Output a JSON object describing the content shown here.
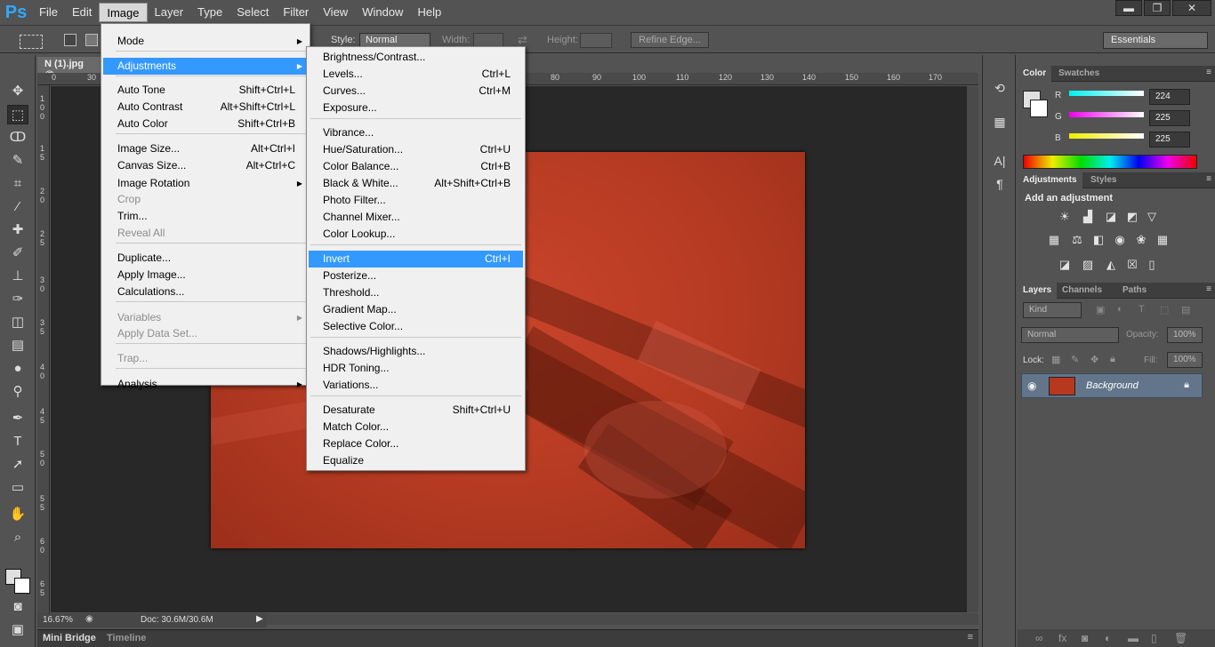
{
  "app": {
    "logo": "Ps"
  },
  "menubar": [
    "File",
    "Edit",
    "Image",
    "Layer",
    "Type",
    "Select",
    "Filter",
    "View",
    "Window",
    "Help"
  ],
  "window_controls": {
    "minimize": "▬",
    "restore": "❐",
    "close": "✕"
  },
  "options": {
    "style_label": "Style:",
    "style_value": "Normal",
    "width_label": "Width:",
    "height_label": "Height:",
    "refine_edge": "Refine Edge...",
    "workspace": "Essentials"
  },
  "document": {
    "tab": "N (1).jpg @",
    "zoom": "16.67%",
    "doc_size": "Doc: 30.6M/30.6M"
  },
  "ruler_top_ticks": [
    "0",
    "30",
    "80",
    "90",
    "100",
    "110",
    "120",
    "130",
    "140",
    "150",
    "160",
    "170"
  ],
  "ruler_left_ticks": [
    "1",
    "0",
    "0",
    "1",
    "5",
    "2",
    "0",
    "2",
    "5",
    "3",
    "0",
    "3",
    "5",
    "4",
    "0",
    "4",
    "5",
    "5",
    "0",
    "5",
    "5",
    "6",
    "0",
    "6",
    "5"
  ],
  "bottom_tabs": {
    "mini_bridge": "Mini Bridge",
    "timeline": "Timeline"
  },
  "image_menu": {
    "items": [
      {
        "label": "Mode",
        "shortcut": "",
        "submenu": true,
        "disabled": false
      },
      {
        "label": "Adjustments",
        "shortcut": "",
        "submenu": true,
        "disabled": false,
        "highlighted": true
      },
      {
        "label": "Auto Tone",
        "shortcut": "Shift+Ctrl+L",
        "disabled": false
      },
      {
        "label": "Auto Contrast",
        "shortcut": "Alt+Shift+Ctrl+L",
        "disabled": false
      },
      {
        "label": "Auto Color",
        "shortcut": "Shift+Ctrl+B",
        "disabled": false
      },
      {
        "label": "Image Size...",
        "shortcut": "Alt+Ctrl+I",
        "disabled": false
      },
      {
        "label": "Canvas Size...",
        "shortcut": "Alt+Ctrl+C",
        "disabled": false
      },
      {
        "label": "Image Rotation",
        "shortcut": "",
        "submenu": true,
        "disabled": false
      },
      {
        "label": "Crop",
        "shortcut": "",
        "disabled": true
      },
      {
        "label": "Trim...",
        "shortcut": "",
        "disabled": false
      },
      {
        "label": "Reveal All",
        "shortcut": "",
        "disabled": true
      },
      {
        "label": "Duplicate...",
        "shortcut": "",
        "disabled": false
      },
      {
        "label": "Apply Image...",
        "shortcut": "",
        "disabled": false
      },
      {
        "label": "Calculations...",
        "shortcut": "",
        "disabled": false
      },
      {
        "label": "Variables",
        "shortcut": "",
        "submenu": true,
        "disabled": true
      },
      {
        "label": "Apply Data Set...",
        "shortcut": "",
        "disabled": true
      },
      {
        "label": "Trap...",
        "shortcut": "",
        "disabled": true
      },
      {
        "label": "Analysis",
        "shortcut": "",
        "submenu": true,
        "disabled": false
      }
    ]
  },
  "adjustments_menu": {
    "items": [
      {
        "label": "Brightness/Contrast...",
        "shortcut": ""
      },
      {
        "label": "Levels...",
        "shortcut": "Ctrl+L"
      },
      {
        "label": "Curves...",
        "shortcut": "Ctrl+M"
      },
      {
        "label": "Exposure...",
        "shortcut": ""
      },
      {
        "label": "Vibrance...",
        "shortcut": ""
      },
      {
        "label": "Hue/Saturation...",
        "shortcut": "Ctrl+U"
      },
      {
        "label": "Color Balance...",
        "shortcut": "Ctrl+B"
      },
      {
        "label": "Black & White...",
        "shortcut": "Alt+Shift+Ctrl+B"
      },
      {
        "label": "Photo Filter...",
        "shortcut": ""
      },
      {
        "label": "Channel Mixer...",
        "shortcut": ""
      },
      {
        "label": "Color Lookup...",
        "shortcut": ""
      },
      {
        "label": "Invert",
        "shortcut": "Ctrl+I",
        "highlighted": true
      },
      {
        "label": "Posterize...",
        "shortcut": ""
      },
      {
        "label": "Threshold...",
        "shortcut": ""
      },
      {
        "label": "Gradient Map...",
        "shortcut": ""
      },
      {
        "label": "Selective Color...",
        "shortcut": ""
      },
      {
        "label": "Shadows/Highlights...",
        "shortcut": ""
      },
      {
        "label": "HDR Toning...",
        "shortcut": ""
      },
      {
        "label": "Variations...",
        "shortcut": ""
      },
      {
        "label": "Desaturate",
        "shortcut": "Shift+Ctrl+U"
      },
      {
        "label": "Match Color...",
        "shortcut": ""
      },
      {
        "label": "Replace Color...",
        "shortcut": ""
      },
      {
        "label": "Equalize",
        "shortcut": ""
      }
    ]
  },
  "color_panel": {
    "tabs": [
      "Color",
      "Swatches"
    ],
    "r_label": "R",
    "g_label": "G",
    "b_label": "B",
    "r": "224",
    "g": "225",
    "b": "225"
  },
  "adjustments_panel": {
    "tabs": [
      "Adjustments",
      "Styles"
    ],
    "heading": "Add an adjustment"
  },
  "layers_panel": {
    "tabs": [
      "Layers",
      "Channels",
      "Paths"
    ],
    "kind": "Kind",
    "blend_mode": "Normal",
    "opacity_label": "Opacity:",
    "opacity": "100%",
    "lock_label": "Lock:",
    "fill_label": "Fill:",
    "fill": "100%",
    "layer_name": "Background"
  },
  "colors": {
    "accent": "#3399ff",
    "menu_bg": "#f0f0f0",
    "canvas_bg": "#282828",
    "photo": "#b53a22",
    "layer_selected": "#62758b"
  }
}
